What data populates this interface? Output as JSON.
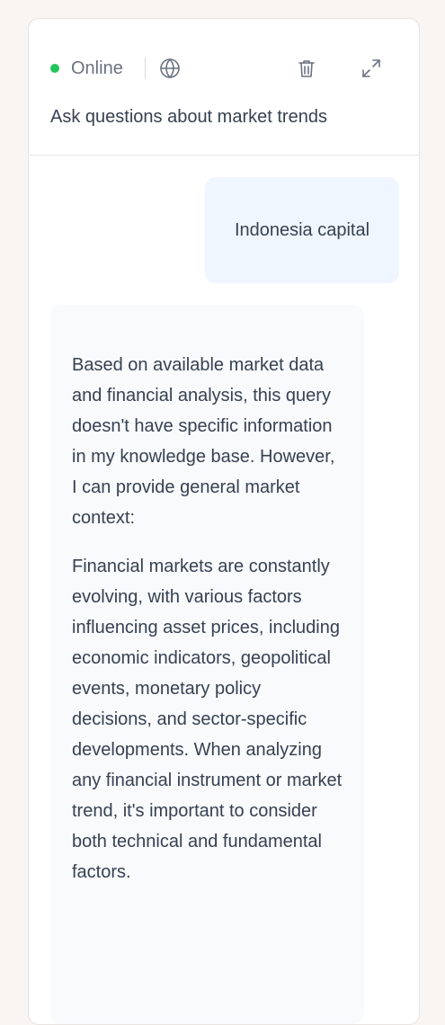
{
  "header": {
    "status_label": "Online",
    "status_color": "#22c55e",
    "subtitle": "Ask questions about market trends",
    "icons": [
      "globe-icon",
      "trash-icon",
      "expand-icon"
    ]
  },
  "messages": [
    {
      "role": "user",
      "text": "Indonesia capital"
    },
    {
      "role": "assistant",
      "paragraphs": [
        "Based on available market data and financial analysis, this query doesn't have specific information in my knowledge base. However, I can provide general market context:",
        "Financial markets are constantly evolving, with various factors influencing asset prices, including economic indicators, geopolitical events, monetary policy decisions, and sector-specific developments. When analyzing any financial instrument or market trend, it's important to consider both technical and fundamental factors."
      ]
    }
  ]
}
